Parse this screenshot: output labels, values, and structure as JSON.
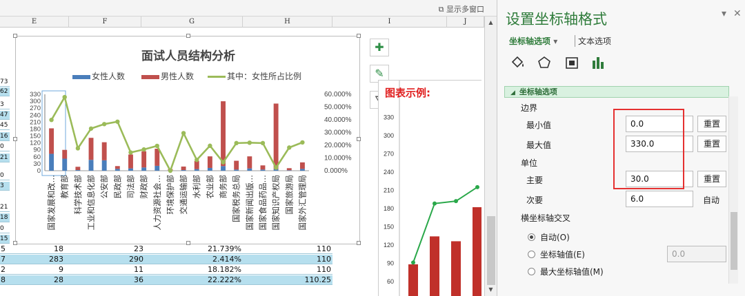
{
  "sheet": {
    "multi_window_label": "显示多窗口",
    "column_headers": [
      "E",
      "F",
      "G",
      "H",
      "I",
      "J"
    ],
    "left_cells": [
      "73",
      "62",
      "3",
      "47",
      "45",
      "16",
      "0",
      "21",
      "0",
      "3",
      "21",
      "18",
      "0",
      "15"
    ],
    "bottom_rows": [
      {
        "c1": "5",
        "c2": "18",
        "c3": "23",
        "c4": "21.739%",
        "c5": "110",
        "hl": false
      },
      {
        "c1": "7",
        "c2": "283",
        "c3": "290",
        "c4": "2.414%",
        "c5": "110",
        "hl": true
      },
      {
        "c1": "2",
        "c2": "9",
        "c3": "11",
        "c4": "18.182%",
        "c5": "110",
        "hl": false
      },
      {
        "c1": "8",
        "c2": "28",
        "c3": "36",
        "c4": "22.222%",
        "c5": "110.25",
        "hl": true
      }
    ]
  },
  "chart_data": [
    {
      "type": "bar",
      "title": "面试人员结构分析",
      "legend": [
        "女性人数",
        "男性人数",
        "其中：女性所占比例"
      ],
      "colors": {
        "female": "#4a7ebb",
        "male": "#c0504d",
        "ratio": "#9bbb59"
      },
      "categories": [
        "国家发展和改…",
        "教育部",
        "科学技术部",
        "工业和信息化部",
        "公安部",
        "民政部",
        "司法部",
        "财政部",
        "人力资源社会…",
        "环境保护部",
        "交通运输部",
        "水利部",
        "农业部",
        "商务部",
        "国家税务总局",
        "国家新闻出版…",
        "国家食品药品…",
        "国家知识产权局",
        "国家旅游局",
        "国家外汇管理局"
      ],
      "series": [
        {
          "name": "女性人数",
          "stacked": true,
          "values": [
            73,
            52,
            3,
            47,
            45,
            8,
            10,
            14,
            21,
            0,
            3,
            7,
            12,
            20,
            5,
            10,
            5,
            7,
            2,
            8
          ]
        },
        {
          "name": "男性人数",
          "stacked": true,
          "values": [
            110,
            38,
            14,
            95,
            78,
            12,
            60,
            70,
            74,
            7,
            15,
            35,
            50,
            280,
            38,
            52,
            18,
            283,
            9,
            28
          ]
        },
        {
          "name": "其中：女性所占比例",
          "type": "line",
          "axis": "right",
          "values": [
            39.9,
            57.8,
            17.6,
            33.1,
            36.6,
            38.5,
            14.3,
            16.7,
            19.5,
            0,
            29.5,
            8.5,
            19.6,
            6.6,
            21.7,
            22.0,
            21.7,
            2.414,
            18.182,
            22.222
          ]
        }
      ],
      "ylim": [
        0,
        330
      ],
      "y_ticks": [
        "330",
        "300",
        "270",
        "240",
        "210",
        "180",
        "150",
        "120",
        "90",
        "60",
        "30",
        "0"
      ],
      "y2_ticks": [
        "60.000%",
        "50.000%",
        "40.000%",
        "30.000%",
        "20.000%",
        "10.000%",
        "0.000%"
      ],
      "y2lim": [
        0,
        60
      ]
    },
    {
      "type": "bar",
      "title": "图表示例:",
      "y_ticks": [
        "330",
        "300",
        "270",
        "240",
        "210",
        "180",
        "150",
        "120",
        "90",
        "60"
      ],
      "ylim": [
        45,
        345
      ],
      "bars": [
        88,
        134,
        126,
        182
      ],
      "line": [
        91,
        188,
        192,
        215
      ]
    }
  ],
  "panel": {
    "title": "设置坐标轴格式",
    "pin_glyph": "▾",
    "close_glyph": "✕",
    "tab_axis_options": "坐标轴选项",
    "tab_axis_arrow": "▾",
    "tab_text_options": "文本选项",
    "section_title": "坐标轴选项",
    "section_arrow": "◢",
    "bounds_label": "边界",
    "min_label": "最小值",
    "min_value": "0.0",
    "max_label": "最大值",
    "max_value": "330.0",
    "units_label": "单位",
    "major_label": "主要",
    "major_value": "30.0",
    "minor_label": "次要",
    "minor_value": "6.0",
    "auto_text": "自动",
    "reset_label": "重置",
    "cross_label": "横坐标轴交叉",
    "radio_auto": "自动(O)",
    "radio_axis_value": "坐标轴值(E)",
    "axis_value": "0.0",
    "radio_max": "最大坐标轴值(M)",
    "accent": "#2f7c3b"
  }
}
